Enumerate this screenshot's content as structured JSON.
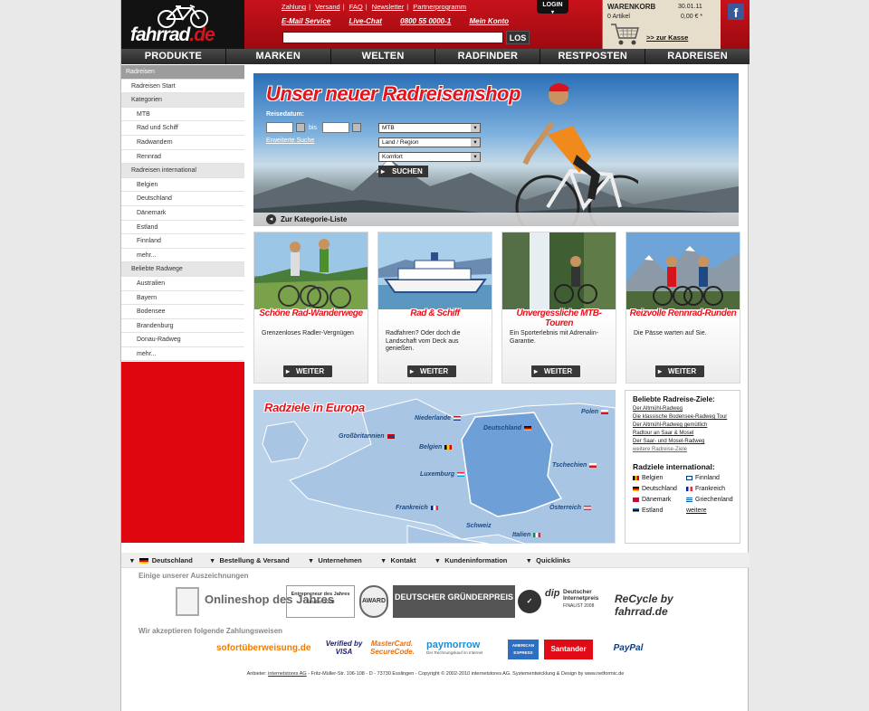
{
  "header": {
    "logo": {
      "text": "fahrrad",
      "suffix": ".de"
    },
    "top_links": [
      "Zahlung",
      "Versand",
      "FAQ",
      "Newsletter",
      "Partnerprogramm"
    ],
    "service_links": [
      "E-Mail Service",
      "Live-Chat",
      "0800 55 0000-1",
      "Mein Konto"
    ],
    "search": {
      "placeholder": "",
      "button": "LOS"
    },
    "login": "LOGIN",
    "cart": {
      "label": "WARENKORB",
      "date": "30.01.11",
      "items": "0 Artikel",
      "total": "0,00 € *",
      "checkout": ">> zur Kasse"
    },
    "facebook": "f"
  },
  "nav": [
    "PRODUKTE",
    "MARKEN",
    "WELTEN",
    "RADFINDER",
    "RESTPOSTEN",
    "RADREISEN"
  ],
  "sidebar": {
    "title": "Radreisen",
    "start": "Radreisen Start",
    "sections": [
      {
        "title": "Kategorien",
        "items": [
          "MTB",
          "Rad und Schiff",
          "Radwandern",
          "Rennrad"
        ]
      },
      {
        "title": "Radreisen international",
        "items": [
          "Belgien",
          "Deutschland",
          "Dänemark",
          "Estland",
          "Finnland",
          "mehr..."
        ]
      },
      {
        "title": "Beliebte Radwege",
        "items": [
          "Australien",
          "Bayern",
          "Bodensee",
          "Brandenburg",
          "Donau-Radweg",
          "mehr..."
        ]
      }
    ]
  },
  "hero": {
    "title": "Unser neuer Radreisenshop",
    "date_label": "Reisedatum:",
    "bis": "bis",
    "advanced_search": "Erweiterte Suche",
    "selects": [
      "MTB",
      "Land / Region",
      "Komfort"
    ],
    "search_button": "SUCHEN",
    "category_list": "Zur Kategorie-Liste"
  },
  "cards": [
    {
      "title": "Schöne Rad-Wanderwege",
      "desc": "Grenzenloses Radler-Vergnügen",
      "button": "WEITER"
    },
    {
      "title": "Rad & Schiff",
      "desc": "Radfahren? Oder doch die Landschaft vom Deck aus genießen.",
      "button": "WEITER"
    },
    {
      "title": "Unvergessliche MTB-Touren",
      "desc": "Ein Sporterlebnis mit Adrenalin-Garantie.",
      "button": "WEITER"
    },
    {
      "title": "Reizvolle Rennrad-Runden",
      "desc": "Die Pässe warten auf Sie.",
      "button": "WEITER"
    }
  ],
  "map": {
    "title": "Radziele in Europa",
    "countries": [
      "Polen",
      "Niederlande",
      "Deutschland",
      "Großbritannien",
      "Belgien",
      "Tschechien",
      "Luxemburg",
      "Frankreich",
      "Österreich",
      "Schweiz",
      "Italien"
    ]
  },
  "destinations": {
    "title": "Beliebte Radreise-Ziele:",
    "links": [
      "Der Altmühl-Radweg",
      "Die klassische Bodensee-Radweg Tour",
      "Der Altmühl-Radweg gemütlich",
      "Radtour an Saar & Mosel",
      "Der Saar- und Mosel-Radweg",
      "weitere Radreise-Ziele"
    ],
    "intl_title": "Radziele international:",
    "intl": [
      "Belgien",
      "Finnland",
      "Deutschland",
      "Frankreich",
      "Dänemark",
      "Griechenland",
      "Estland",
      "weitere"
    ]
  },
  "footer": {
    "nav": [
      "Deutschland",
      "Bestellung & Versand",
      "Unternehmen",
      "Kontakt",
      "Kundeninformation",
      "Quicklinks"
    ],
    "awards_title": "Einige unserer Auszeichnungen",
    "awards": [
      "Onlineshop des Jahres",
      "Entrepreneur des Jahres",
      "AWARD",
      "DEUTSCHER GRÜNDERPREIS",
      "Deutscher Internetpreis",
      "ReCycle by fahrrad.de"
    ],
    "award_sub": [
      "Finalist 2008",
      "FINALIST 2008"
    ],
    "payment_title": "Wir akzeptieren folgende Zahlungsweisen",
    "payments": [
      "sofortüberweisung.de",
      "Verified by VISA",
      "MasterCard. SecureCode.",
      "paymorrow",
      "AMERICAN EXPRESS",
      "Santander",
      "PayPal"
    ],
    "payment_sub": "Der Rechnungskauf im Internet",
    "impressum_pre": "Anbieter:",
    "impressum_link": "internetstores AG",
    "impressum_post": "- Fritz-Müller-Str. 106-108 - D - 73730 Esslingen - Copyright © 2002-2010 internetstores AG. Systementwicklung & Design by www.netformic.de"
  },
  "colors": {
    "brand_red": "#d6141c",
    "nav_dark": "#333333",
    "link_blue": "#1d4a84"
  }
}
